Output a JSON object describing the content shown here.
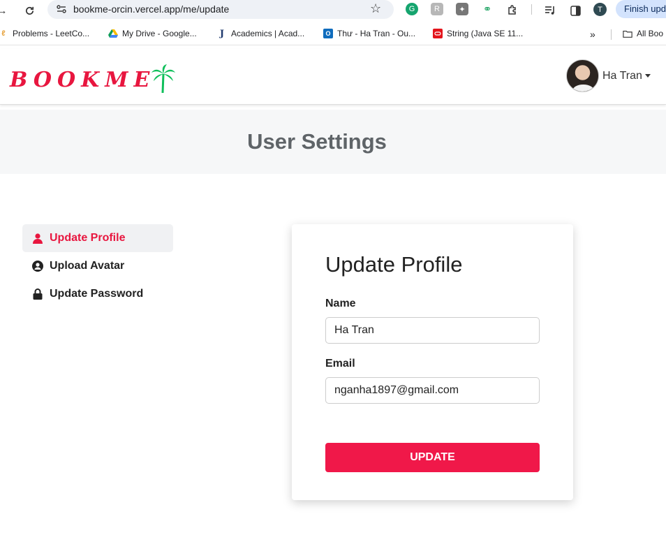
{
  "browser": {
    "url": "bookme-orcin.vercel.app/me/update",
    "finish_update_label": "Finish upd",
    "profile_initial": "T",
    "bookmarks": [
      {
        "label": "Problems - LeetCo...",
        "icon": "leetcode-icon"
      },
      {
        "label": "My Drive - Google...",
        "icon": "google-drive-icon"
      },
      {
        "label": "Academics | Acad...",
        "icon": "j-icon"
      },
      {
        "label": "Thư - Ha Tran - Ou...",
        "icon": "outlook-icon"
      },
      {
        "label": "String (Java SE 11...",
        "icon": "oracle-icon"
      }
    ],
    "all_bookmarks_label": "All Boo"
  },
  "header": {
    "logo_text": "BOOKME",
    "user_name": "Ha Tran"
  },
  "banner": {
    "title": "User Settings"
  },
  "sidebar": {
    "items": [
      {
        "label": "Update Profile",
        "icon": "user-icon",
        "active": true
      },
      {
        "label": "Upload Avatar",
        "icon": "user-circle-icon",
        "active": false
      },
      {
        "label": "Update Password",
        "icon": "lock-icon",
        "active": false
      }
    ]
  },
  "form": {
    "title": "Update Profile",
    "name_label": "Name",
    "name_value": "Ha Tran",
    "email_label": "Email",
    "email_value": "nganha1897@gmail.com",
    "submit_label": "UPDATE"
  },
  "colors": {
    "accent": "#f01849",
    "logo_red": "#e8163f",
    "palm_green": "#0fbf5b"
  }
}
